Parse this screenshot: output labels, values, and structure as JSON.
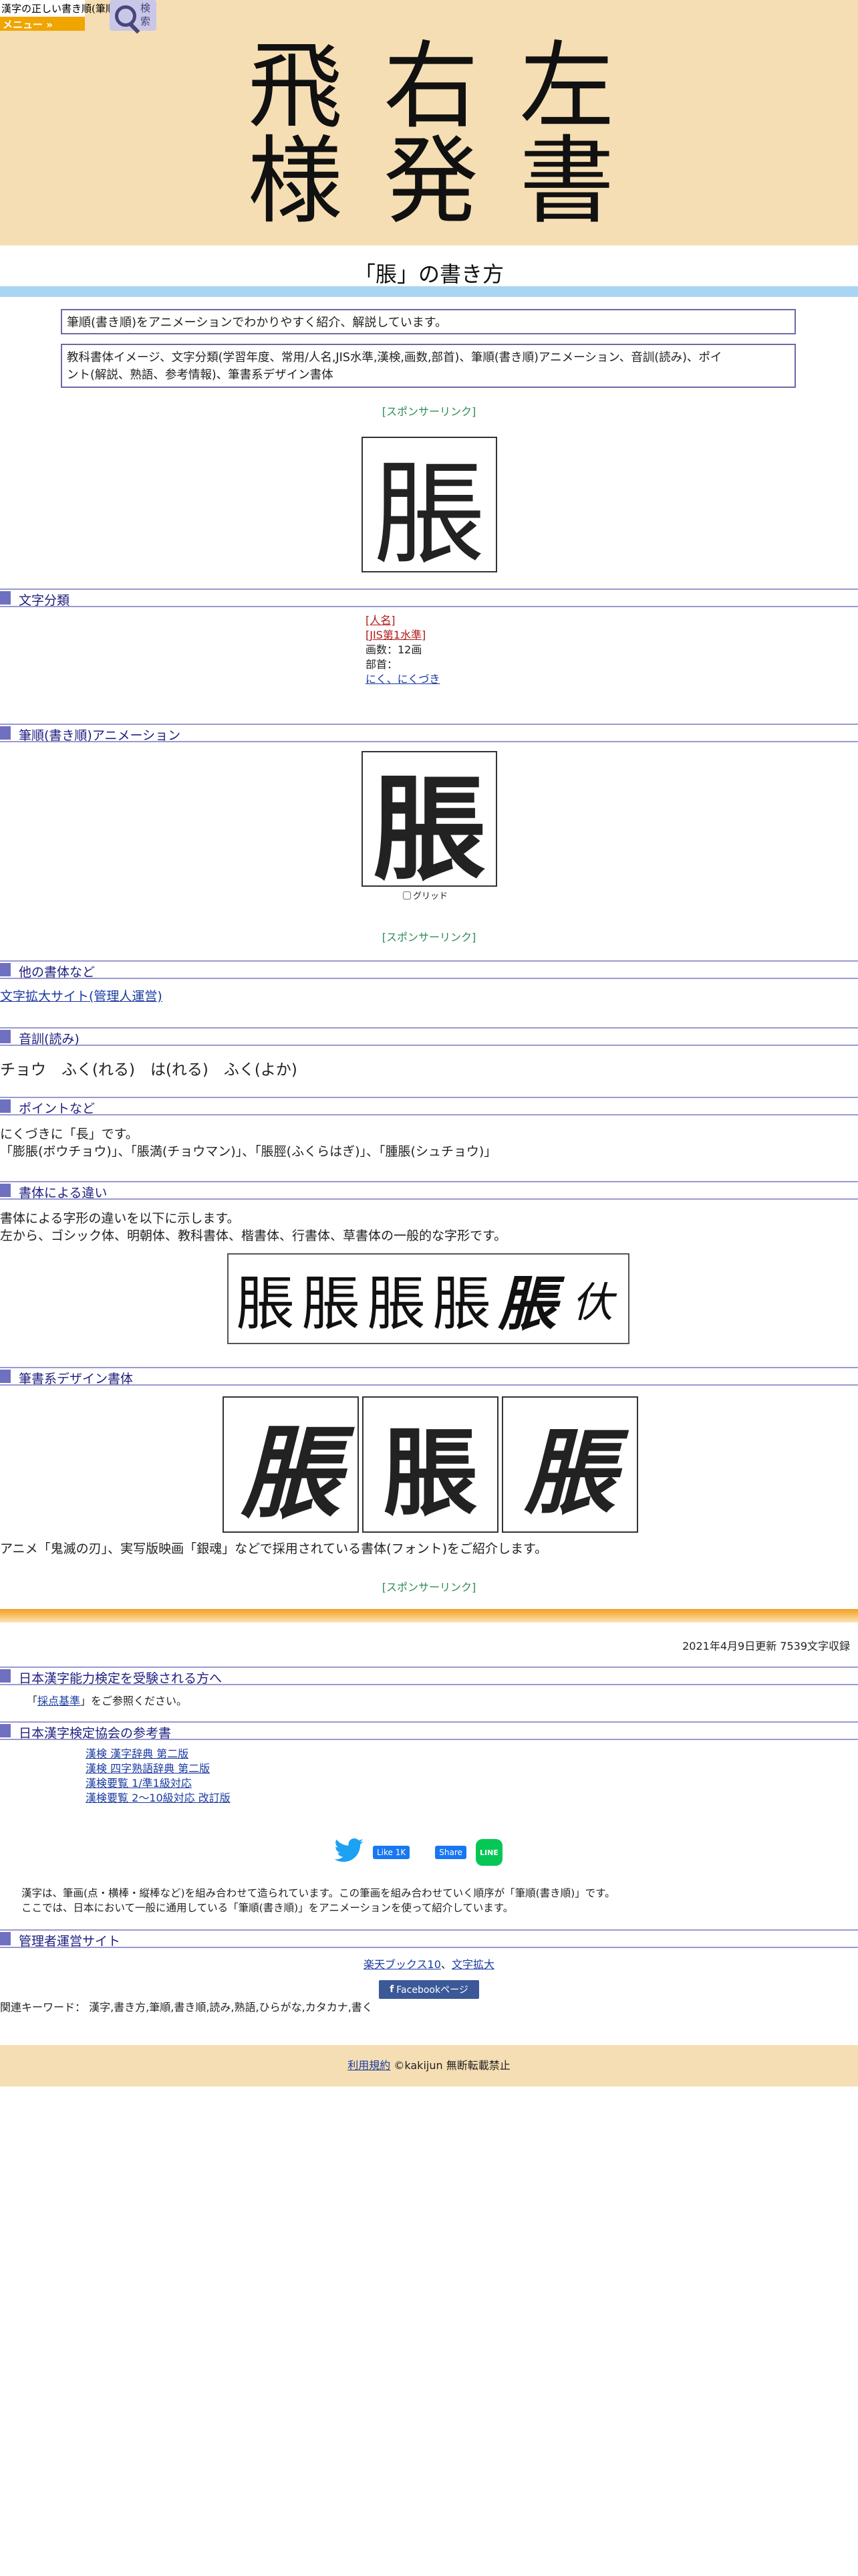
{
  "header": {
    "logo_text": "漢字の正しい書き順(筆順)",
    "menu_label": "メニュー »",
    "search_label": "検索"
  },
  "hero": {
    "row1": [
      "飛",
      "右",
      "左"
    ],
    "row2": [
      "様",
      "発",
      "書"
    ]
  },
  "page": {
    "title": "「脹」の書き方",
    "intro1": "筆順(書き順)をアニメーションでわかりやすく紹介、解説しています。",
    "intro2_line1": "教科書体イメージ、文字分類(学習年度、常用/人名,JIS水準,漢検,画数,部首)、筆順(書き順)アニメーション、音訓(読み)、ポイ",
    "intro2_line2": "ント(解説、熟語、参考情報)、筆書系デザイン書体",
    "sponsor_link": "[スポンサーリンク]",
    "main_char": "脹"
  },
  "sections": {
    "classification": "文字分類",
    "animation": "筆順(書き順)アニメーション",
    "other_fonts": "他の書体など",
    "readings": "音訓(読み)",
    "points": "ポイントなど",
    "font_diff": "書体による違い",
    "design_fonts": "筆書系デザイン書体",
    "kentei": "日本漢字能力検定を受験される方へ",
    "kentei_ref": "日本漢字検定協会の参考書",
    "admin_sites": "管理者運営サイト"
  },
  "classification": {
    "jinmei": "[人名]",
    "jis": "[JIS第1水準]",
    "strokes": "画数：12画",
    "radical_label": "部首：",
    "radical": "にく、にくづき"
  },
  "animation": {
    "grid_label": "グリッド",
    "grid_checked": false
  },
  "other_fonts": {
    "link": "文字拡大サイト(管理人運営)"
  },
  "readings": {
    "text": "チョウ　ふく(れる)　は(れる)　ふく(よか)"
  },
  "points": {
    "line1": "にくづきに「長」です。",
    "line2": "「膨脹(ボウチョウ)」、「脹満(チョウマン)」、「脹脛(ふくらはぎ)」、「腫脹(シュチョウ)」"
  },
  "font_diff": {
    "line1": "書体による字形の違いを以下に示します。",
    "line2": "左から、ゴシック体、明朝体、教科書体、楷書体、行書体、草書体の一般的な字形です。",
    "chars": [
      "脹",
      "脹",
      "脹",
      "脹",
      "脹",
      "㐲"
    ]
  },
  "design_fonts": {
    "chars": [
      "脹",
      "脹",
      "脹"
    ],
    "caption": "アニメ「鬼滅の刃」、実写版映画「銀魂」などで採用されている書体(フォント)をご紹介します。"
  },
  "updated": "2021年4月9日更新 7539文字収録",
  "kentei": {
    "prefix": "「",
    "link": "採点基準",
    "suffix": "」をご参照ください。"
  },
  "kentei_ref": {
    "links": [
      "漢検 漢字辞典 第二版",
      "漢検 四字熟語辞典 第二版",
      "漢検要覧 1/準1級対応",
      "漢検要覧 2～10級対応 改訂版"
    ]
  },
  "share": {
    "fb_like": "Like 1K",
    "fb_share": "Share",
    "line": "LINE"
  },
  "about": {
    "line1": "漢字は、筆画(点・横棒・縦棒など)を組み合わせて造られています。この筆画を組み合わせていく順序が「筆順(書き順)」です。",
    "line2": "ここでは、日本において一般に通用している「筆順(書き順)」をアニメーションを使って紹介しています。"
  },
  "admin": {
    "link1": "楽天ブックス10",
    "sep": "、",
    "link2": "文字拡大",
    "fb_page": "Facebookページ",
    "keywords": "関連キーワード： 漢字,書き方,筆順,書き順,読み,熟語,ひらがな,カタカナ,書く"
  },
  "footer": {
    "terms": "利用規約",
    "copyright": "©kakijun 無断転載禁止"
  },
  "colors": {
    "hero_bg": "#f5deb3",
    "menu_orange": "#f0a500",
    "section_accent": "#7070c0",
    "sponsor_green": "#2e8b57"
  }
}
